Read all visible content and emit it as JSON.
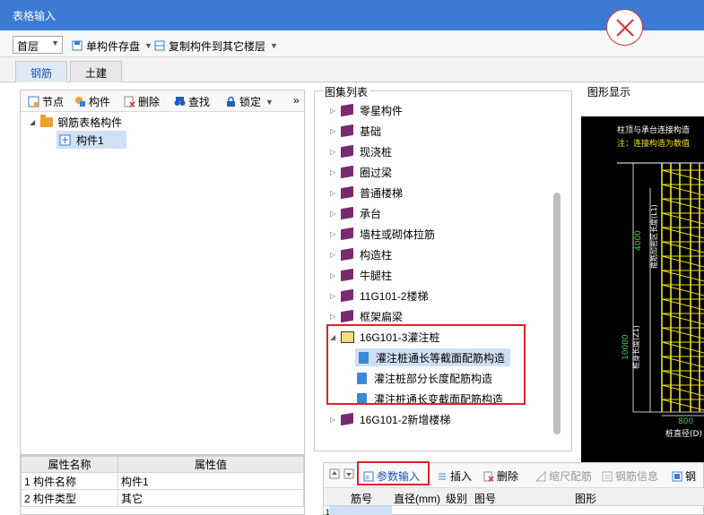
{
  "window": {
    "title": "表格输入"
  },
  "toolbar": {
    "floor": "首层",
    "save_component": "单构件存盘",
    "copy_component": "复制构件到其它楼层"
  },
  "tabs": [
    {
      "label": "钢筋",
      "active": true
    },
    {
      "label": "土建",
      "active": false
    }
  ],
  "left_toolbar": {
    "node": "节点",
    "component": "构件",
    "delete": "删除",
    "find": "查找",
    "lock": "锁定",
    "more": "»"
  },
  "tree": {
    "root": "钢筋表格构件",
    "child": "构件1"
  },
  "properties": {
    "headers": [
      "属性名称",
      "属性值"
    ],
    "rows": [
      {
        "no": "1",
        "name": "构件名称",
        "value": "构件1"
      },
      {
        "no": "2",
        "name": "构件类型",
        "value": "其它"
      }
    ]
  },
  "atlas": {
    "title": "图集列表",
    "items": [
      "零星构件",
      "基础",
      "现浇桩",
      "圈过梁",
      "普通楼梯",
      "承台",
      "墙柱或砌体拉筋",
      "构造柱",
      "牛腿柱",
      "11G101-2楼梯",
      "框架扁梁"
    ],
    "expanded": {
      "label": "16G101-3灌注桩",
      "children": [
        "灌注桩通长等截面配筋构造",
        "灌注桩部分长度配筋构造",
        "灌注桩通长变截面配筋构造"
      ]
    },
    "last": "16G101-2新增楼梯"
  },
  "graph": {
    "title": "图形显示",
    "note1": "柱顶与承台连接构造",
    "note2": "注：连接构造为数值",
    "dim_top": "4000",
    "dim_mid": "10000",
    "label_top": "箍筋加密区长度(L1)",
    "label_mid": "桩身长度(Z1)",
    "dim_bottom": "800",
    "label_bottom": "桩直径(D)"
  },
  "bottom_toolbar": {
    "param_input": "参数输入",
    "insert": "插入",
    "delete": "删除",
    "scale": "缩尺配筋",
    "rebar_info": "钢筋信息",
    "rebar": "钢"
  },
  "bottom_table": {
    "columns": [
      "筋号",
      "直径(mm)",
      "级别",
      "图号",
      "图形"
    ],
    "row_no": "1"
  },
  "colors": {
    "title_bar": "#3b7bd4",
    "highlight_red": "#e0212c",
    "selection": "#cfe0f5",
    "drawing_yellow": "#f2e400"
  }
}
